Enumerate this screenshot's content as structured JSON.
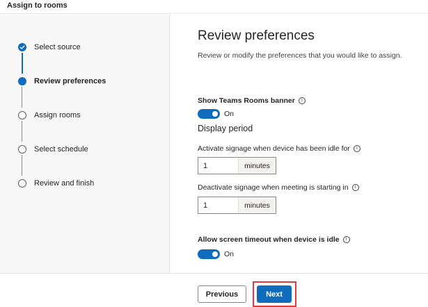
{
  "header": {
    "title": "Assign to rooms"
  },
  "steps": [
    {
      "label": "Select source",
      "state": "done"
    },
    {
      "label": "Review preferences",
      "state": "current"
    },
    {
      "label": "Assign rooms",
      "state": "pending"
    },
    {
      "label": "Select schedule",
      "state": "pending"
    },
    {
      "label": "Review and finish",
      "state": "pending"
    }
  ],
  "main": {
    "title": "Review preferences",
    "subtitle": "Review or modify the preferences that you would like to assign.",
    "banner": {
      "label": "Show Teams Rooms banner",
      "state": "On",
      "enabled": true
    },
    "display_period": {
      "title": "Display period",
      "activate": {
        "label": "Activate signage when device has been idle for",
        "value": "1",
        "unit": "minutes"
      },
      "deactivate": {
        "label": "Deactivate signage when meeting is starting in",
        "value": "1",
        "unit": "minutes"
      }
    },
    "timeout": {
      "label": "Allow screen timeout when device is idle",
      "state": "On",
      "enabled": true
    }
  },
  "footer": {
    "previous_label": "Previous",
    "next_label": "Next"
  },
  "colors": {
    "accent": "#0f6cbd",
    "highlight": "#e03c3c"
  },
  "icons": {
    "info": "info-circle-icon",
    "check": "checkmark-icon"
  }
}
